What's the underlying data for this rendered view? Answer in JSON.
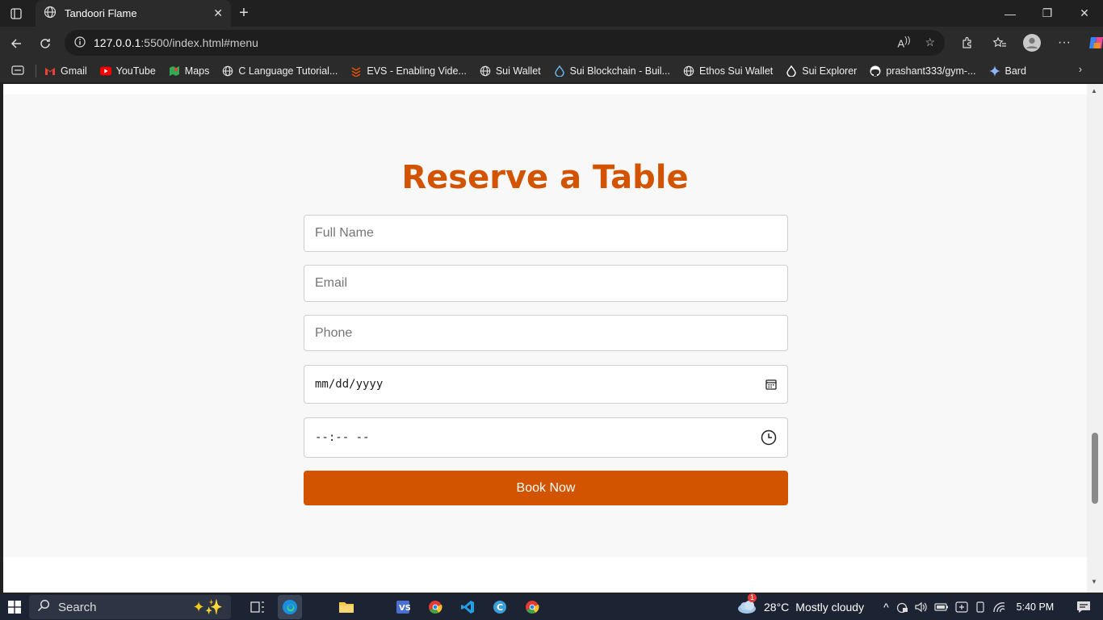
{
  "browser": {
    "tab_title": "Tandoori Flame",
    "url_host": "127.0.0.1",
    "url_rest": ":5500/index.html#menu"
  },
  "bookmarks": [
    {
      "label": "Gmail",
      "icon": "gmail-icon",
      "color": "#ea4335"
    },
    {
      "label": "YouTube",
      "icon": "youtube-icon",
      "color": "#ff0000"
    },
    {
      "label": "Maps",
      "icon": "maps-icon",
      "color": "#34a853"
    },
    {
      "label": "C Language Tutorial...",
      "icon": "globe-icon",
      "color": "#dddddd"
    },
    {
      "label": "EVS - Enabling Vide...",
      "icon": "evs-icon",
      "color": "#e65100"
    },
    {
      "label": "Sui Wallet",
      "icon": "globe-icon",
      "color": "#dddddd"
    },
    {
      "label": "Sui Blockchain - Buil...",
      "icon": "sui-drop-icon",
      "color": "#6fbcf0"
    },
    {
      "label": "Ethos Sui Wallet",
      "icon": "globe-icon",
      "color": "#dddddd"
    },
    {
      "label": "Sui Explorer",
      "icon": "sui-drop-icon",
      "color": "#ffffff"
    },
    {
      "label": "prashant333/gym-...",
      "icon": "github-icon",
      "color": "#ffffff"
    },
    {
      "label": "Bard",
      "icon": "bard-icon",
      "color": "#8ab4f8"
    }
  ],
  "page": {
    "heading": "Reserve a Table",
    "name_placeholder": "Full Name",
    "email_placeholder": "Email",
    "phone_placeholder": "Phone",
    "date_value": "mm/dd/yyyy",
    "time_value": "--:-- --",
    "submit_label": "Book Now",
    "accent_color": "#d35400"
  },
  "taskbar": {
    "search_label": "Search",
    "weather_temp": "28°C",
    "weather_desc": "Mostly cloudy",
    "weather_badge": "1",
    "time": "5:40 PM"
  }
}
